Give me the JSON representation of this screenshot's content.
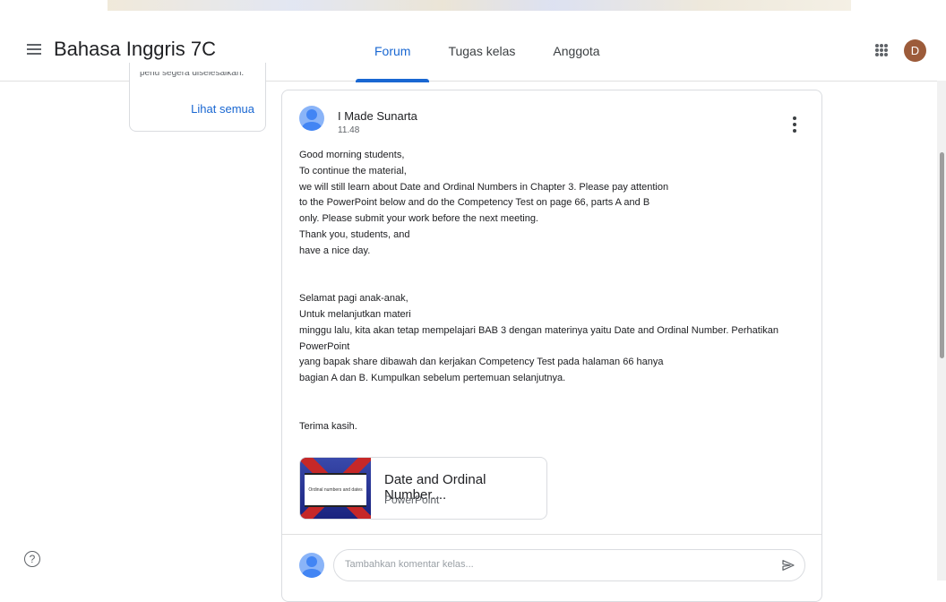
{
  "header": {
    "class_title": "Bahasa Inggris 7C",
    "tabs": [
      {
        "label": "Forum",
        "active": true
      },
      {
        "label": "Tugas kelas",
        "active": false
      },
      {
        "label": "Anggota",
        "active": false
      }
    ],
    "avatar_initial": "D",
    "accent_color": "#1967d2"
  },
  "sidebar": {
    "partial_text": "perlu segera diselesaikan.",
    "see_all_label": "Lihat semua"
  },
  "post": {
    "author": "I Made Sunarta",
    "time": "11.48",
    "body": "Good morning students,\nTo continue the material,\nwe will still learn about Date and Ordinal Numbers in Chapter 3. Please pay attention\nto the PowerPoint below and do the Competency Test on page 66, parts A and B\nonly. Please submit your work before the next meeting.\nThank you, students, and\nhave a nice day.\n\n\nSelamat pagi anak-anak,\nUntuk melanjutkan materi\nminggu lalu, kita akan tetap mempelajari BAB 3 dengan materinya yaitu Date and Ordinal Number.  Perhatikan PowerPoint\nyang bapak share dibawah dan kerjakan Competency Test pada halaman 66 hanya\nbagian A dan B. Kumpulkan sebelum pertemuan selanjutnya.\n\n\nTerima kasih.",
    "attachment": {
      "title": "Date and Ordinal Number....",
      "type": "PowerPoint",
      "thumbnail_text": "Ordinal numbers and dates"
    },
    "comment_placeholder": "Tambahkan komentar kelas..."
  },
  "icons": {
    "menu": "menu-icon",
    "apps": "apps-icon",
    "more": "more-vert-icon",
    "send": "send-icon",
    "help": "help-icon"
  }
}
